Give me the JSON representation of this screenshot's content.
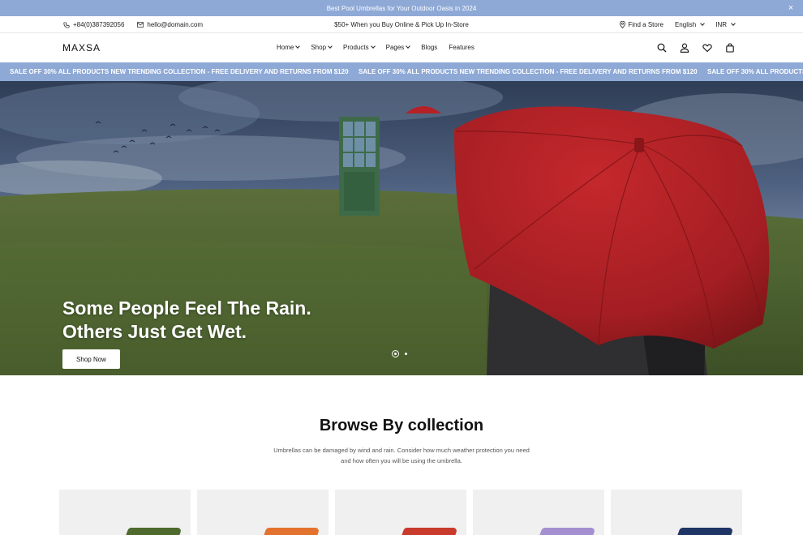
{
  "announcement": {
    "text": "Best Pool Umbrellas for Your Outdoor Oasis in 2024",
    "close": "×"
  },
  "topbar": {
    "phone": "+84(0)387392056",
    "email": "hello@domain.com",
    "promo": "$50+ When you Buy Online & Pick Up In-Store",
    "find_store": "Find a Store",
    "language": "English",
    "currency": "INR"
  },
  "header": {
    "logo": "MAXSA",
    "nav": [
      {
        "label": "Home",
        "dropdown": true
      },
      {
        "label": "Shop",
        "dropdown": true
      },
      {
        "label": "Products",
        "dropdown": true
      },
      {
        "label": "Pages",
        "dropdown": true
      },
      {
        "label": "Blogs",
        "dropdown": false
      },
      {
        "label": "Features",
        "dropdown": false
      }
    ],
    "icons": [
      "search-icon",
      "account-icon",
      "wishlist-icon",
      "cart-icon"
    ]
  },
  "marquee": {
    "text": "SALE OFF 30% ALL PRODUCTS NEW TRENDING COLLECTION - FREE DELIVERY AND RETURNS FROM $120"
  },
  "hero": {
    "title_line1": "Some People Feel The Rain.",
    "title_line2": "Others Just Get Wet.",
    "button": "Shop Now",
    "slide_count": 2,
    "active_slide": 1
  },
  "collection": {
    "title": "Browse By collection",
    "description": "Umbrellas can be damaged by wind and rain. Consider how much weather protection you need and how often you will be using the umbrella.",
    "cards": [
      {
        "color": "#4e6a2e"
      },
      {
        "color": "#e3722f"
      },
      {
        "color": "#c83a2b"
      },
      {
        "color": "#a48fd1"
      },
      {
        "color": "#1f3566"
      }
    ]
  },
  "colors": {
    "accent": "#8ea9d6",
    "umbrella_red": "#b52126"
  }
}
